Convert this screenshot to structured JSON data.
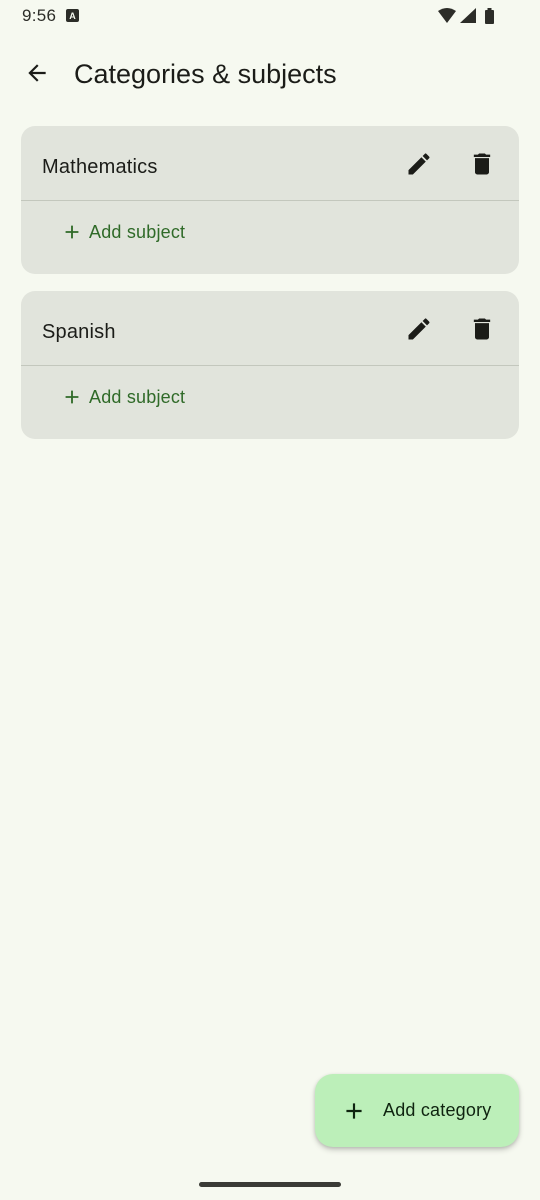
{
  "status_bar": {
    "time": "9:56",
    "notification_icon": "a-icon",
    "icons": [
      "wifi-icon",
      "signal-icon",
      "battery-icon"
    ]
  },
  "app_bar": {
    "back_icon": "arrow-back-icon",
    "title": "Categories & subjects"
  },
  "categories": [
    {
      "name": "Mathematics",
      "edit_icon": "pencil-icon",
      "delete_icon": "trash-icon",
      "add_subject_label": "Add subject"
    },
    {
      "name": "Spanish",
      "edit_icon": "pencil-icon",
      "delete_icon": "trash-icon",
      "add_subject_label": "Add subject"
    }
  ],
  "fab": {
    "icon": "plus-icon",
    "label": "Add category"
  },
  "colors": {
    "background": "#f6f9f0",
    "card": "#e1e4dc",
    "accent_text": "#2f6a28",
    "fab": "#bcefb9"
  }
}
